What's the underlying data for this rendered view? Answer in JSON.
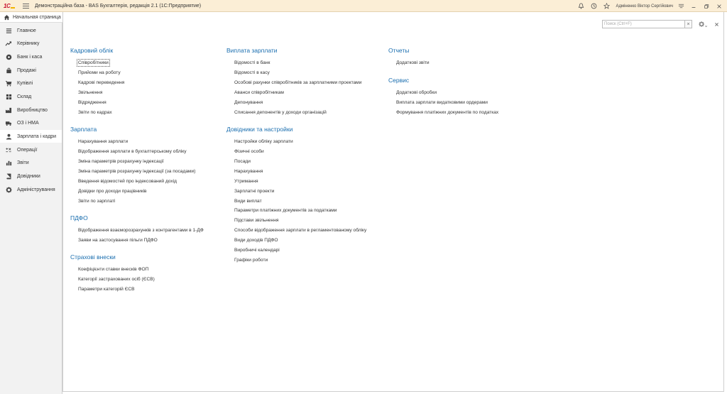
{
  "titlebar": {
    "title": "Демонстраційна база - BAS Бухгалтерія, редакція 2.1  (1С:Предприятие)",
    "user": "Адміненко Віктор Сергійович"
  },
  "home": {
    "label": "Начальная страница"
  },
  "sidebar": {
    "items": [
      {
        "label": "Главное",
        "icon": "list-icon"
      },
      {
        "label": "Керівнику",
        "icon": "trend-icon"
      },
      {
        "label": "Банк і каса",
        "icon": "coin-icon"
      },
      {
        "label": "Продажі",
        "icon": "bag-icon"
      },
      {
        "label": "Купівлі",
        "icon": "cart-icon"
      },
      {
        "label": "Склад",
        "icon": "grid-icon"
      },
      {
        "label": "Виробництво",
        "icon": "factory-icon"
      },
      {
        "label": "ОЗ і НМА",
        "icon": "truck-icon"
      },
      {
        "label": "Зарплата і кадри",
        "icon": "person-icon"
      },
      {
        "label": "Операції",
        "icon": "ops-icon"
      },
      {
        "label": "Звіти",
        "icon": "bar-chart-icon"
      },
      {
        "label": "Довідники",
        "icon": "book-icon"
      },
      {
        "label": "Адміністрування",
        "icon": "gear-icon"
      }
    ],
    "active_index": 8
  },
  "search": {
    "placeholder": "Поиск (Ctrl+F)",
    "clear": "×"
  },
  "sections": {
    "kadrovy": {
      "title": "Кадровий облік",
      "links": [
        "Співробітники",
        "Прийоми на роботу",
        "Кадрові переведення",
        "Звільнення",
        "Відрядження",
        "Звіти по кадрах"
      ]
    },
    "zarplata": {
      "title": "Зарплата",
      "links": [
        "Нарахування зарплати",
        "Відображення зарплати в бухгалтерському обліку",
        "Зміна параметрів розрахунку індексації",
        "Зміна параметрів розрахунку індексації (за посадами)",
        "Введення відомостей про індексований дохід",
        "Довідки про доходи працівників",
        "Звіти по зарплаті"
      ]
    },
    "pdfo": {
      "title": "ПДФО",
      "links": [
        "Відображення взаєморозрахунків з контрагентами в 1-ДФ",
        "Заяви на застосування пільги ПДФО"
      ]
    },
    "strakhovi": {
      "title": "Страхові внески",
      "links": [
        "Коефіцієнти ставки внесків ФОП",
        "Категорії застрахованих осіб (ЄСВ)",
        "Параметри категорій ЄСВ"
      ]
    },
    "vyplata": {
      "title": "Виплата зарплати",
      "links": [
        "Відомості в банк",
        "Відомості в касу",
        "Особові рахунки співробітників за зарплатними проектами",
        "Аванси співробітникам",
        "Депонування",
        "Списання депонентів у доходи організацій"
      ]
    },
    "dovidnyky": {
      "title": "Довідники та настройки",
      "links": [
        "Настройки обліку зарплати",
        "Фізичні особи",
        "Посади",
        "Нарахування",
        "Утримання",
        "Зарплатні проекти",
        "Види виплат",
        "Параметри платіжних документів за податками",
        "Підстави звільнення",
        "Способи відображення зарплати в регламентованому обліку",
        "Види доходів ПДФО",
        "Виробничі календарі",
        "Графіки роботи"
      ]
    },
    "otchety": {
      "title": "Отчеты",
      "links": [
        "Додаткові звіти"
      ]
    },
    "servis": {
      "title": "Сервис",
      "links": [
        "Додаткові обробки",
        "Виплата зарплати видатковими ордерами",
        "Формування платіжних документів по податках"
      ]
    }
  },
  "colors": {
    "section_title": "#1a6eaf",
    "titlebar_bg": "#fbeed6",
    "sidebar_bg": "#f2f2f2"
  }
}
